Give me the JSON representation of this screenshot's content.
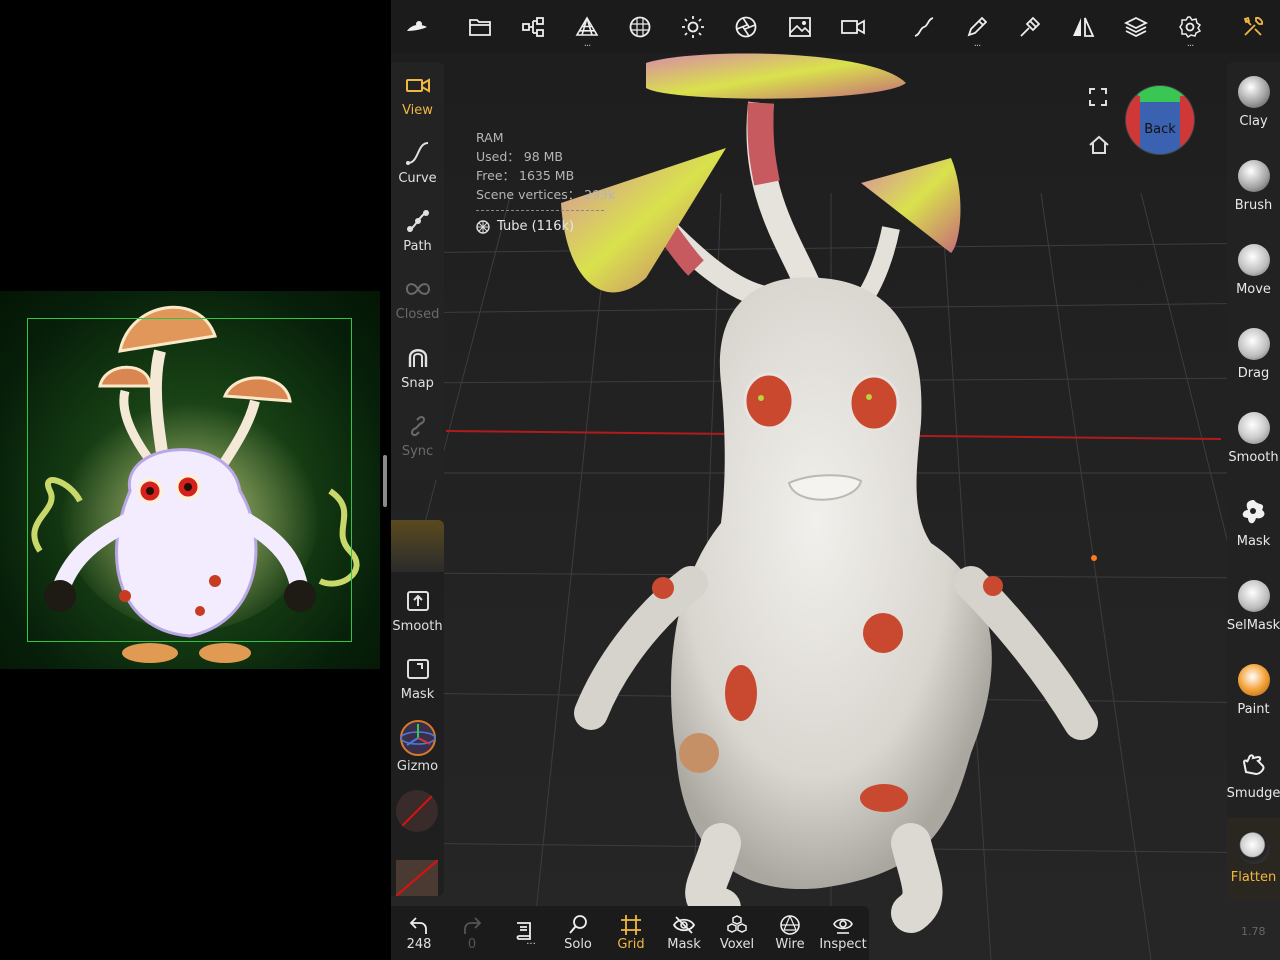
{
  "top_toolbar": {
    "icons": [
      "nomad-logo-icon",
      "folder-icon",
      "scene-tree-icon",
      "topology-icon",
      "material-sphere-icon",
      "light-icon",
      "camera-shutter-icon",
      "background-image-icon",
      "camera-icon",
      "stroke-icon",
      "brush-icon",
      "tool-settings-icon",
      "symmetry-icon",
      "layers-icon",
      "settings-gear-icon",
      "tools-wrench-icon"
    ],
    "dots": "..."
  },
  "info": {
    "ram_title": "RAM",
    "used": "Used： 98 MB",
    "free": "Free： 1635 MB",
    "vertices": "Scene vertices： 293k",
    "selected_object": "Tube (116k)"
  },
  "left_tools": {
    "view": "View",
    "curve": "Curve",
    "path": "Path",
    "closed": "Closed",
    "snap": "Snap",
    "sync": "Sync",
    "smooth": "Smooth",
    "mask": "Mask",
    "gizmo": "Gizmo"
  },
  "right_tools": [
    "Clay",
    "Brush",
    "Move",
    "Drag",
    "Smooth",
    "Mask",
    "SelMask",
    "Paint",
    "Smudge",
    "Flatten"
  ],
  "bottom_toolbar": {
    "undo_count": "248",
    "redo_count": "0",
    "history_dots": "...",
    "solo": "Solo",
    "grid": "Grid",
    "mask": "Mask",
    "voxel": "Voxel",
    "wire": "Wire",
    "inspect": "Inspect"
  },
  "camera_cube": {
    "label": "Back"
  },
  "version": "1.78",
  "colors": {
    "accent": "#f2b740",
    "panel": "#232323",
    "toolbar": "#1b1b1b"
  }
}
